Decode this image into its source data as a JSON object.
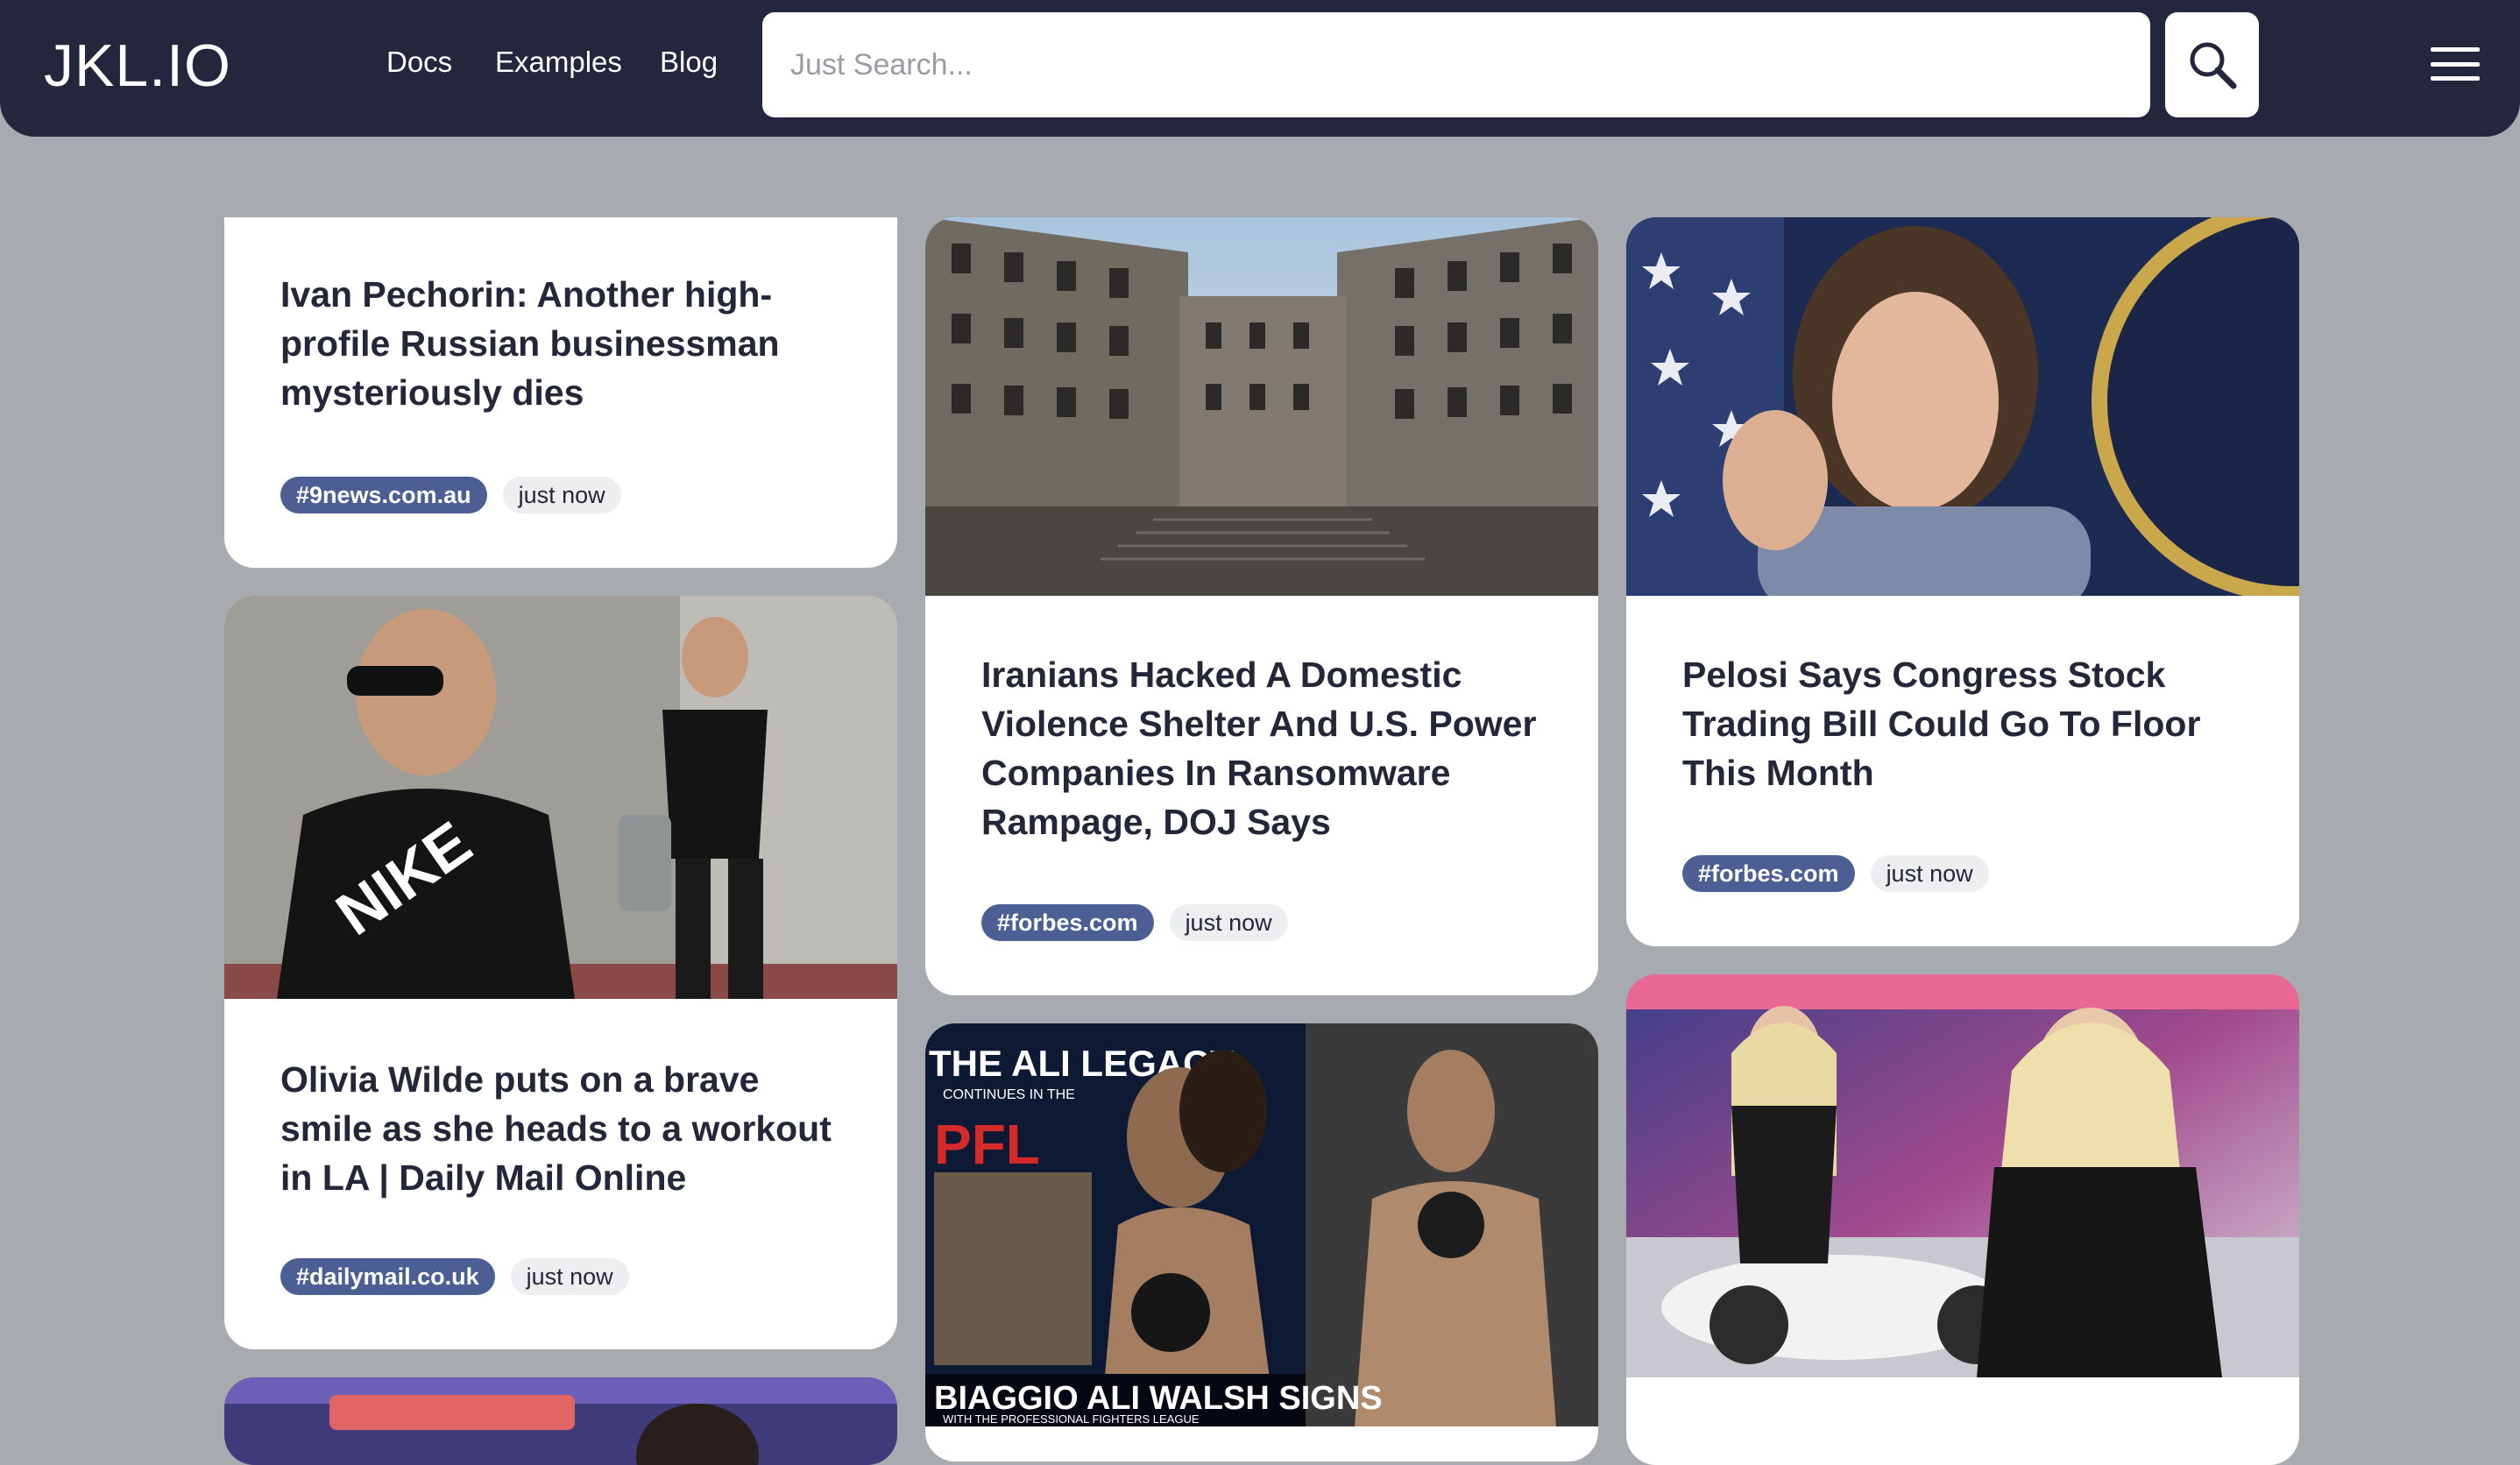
{
  "header": {
    "logo": "JKL.IO",
    "nav": [
      "Docs",
      "Examples",
      "Blog"
    ],
    "search_placeholder": "Just Search...",
    "search_icon": "search-icon",
    "menu_icon": "hamburger-menu-icon"
  },
  "cards": [
    {
      "title": "Ivan Pechorin: Another high-profile Russian businessman mysteriously dies",
      "source": "#9news.com.au",
      "time": "just now"
    },
    {
      "title": "Iranians Hacked A Domestic Violence Shelter And U.S. Power Companies In Ransomware Rampage, DOJ Says",
      "source": "#forbes.com",
      "time": "just now"
    },
    {
      "title": "Pelosi Says Congress Stock Trading Bill Could Go To Floor This Month",
      "source": "#forbes.com",
      "time": "just now"
    },
    {
      "title": "Olivia Wilde puts on a brave smile as she heads to a workout in LA | Daily Mail Online",
      "source": "#dailymail.co.uk",
      "time": "just now"
    },
    {
      "image_text": {
        "line1": "THE ALI LEGACY",
        "line2": "CONTINUES IN THE",
        "brand": "PFL",
        "caption": "BIAGGIO ALI WALSH SIGNS",
        "subcaption": "WITH THE PROFESSIONAL FIGHTERS LEAGUE"
      }
    }
  ],
  "colors": {
    "header_bg": "#23263c",
    "page_bg": "#a7abb0",
    "tag_source_bg": "#4c5f94",
    "tag_time_bg": "#eceef0",
    "title_text": "#24263a"
  }
}
